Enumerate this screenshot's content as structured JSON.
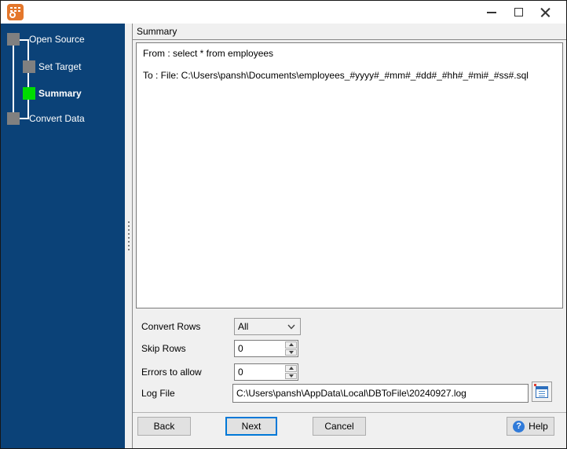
{
  "window": {
    "title": "",
    "app_icon": "database-to-file-app-icon",
    "controls": {
      "minimize": "minimize",
      "maximize": "maximize",
      "close": "close"
    }
  },
  "sidebar": {
    "steps": [
      {
        "label": "Open Source",
        "state": "done"
      },
      {
        "label": "Set Target",
        "state": "done"
      },
      {
        "label": "Summary",
        "state": "current"
      },
      {
        "label": "Convert Data",
        "state": "pending"
      }
    ]
  },
  "main": {
    "header": "Summary",
    "summary": {
      "from_line": "From : select * from employees",
      "to_line": "To : File: C:\\Users\\pansh\\Documents\\employees_#yyyy#_#mm#_#dd#_#hh#_#mi#_#ss#.sql"
    },
    "form": {
      "convert_rows": {
        "label": "Convert Rows",
        "value": "All"
      },
      "skip_rows": {
        "label": "Skip Rows",
        "value": "0"
      },
      "errors_to_allow": {
        "label": "Errors to allow",
        "value": "0"
      },
      "log_file": {
        "label": "Log File",
        "value": "C:\\Users\\pansh\\AppData\\Local\\DBToFile\\20240927.log"
      }
    },
    "buttons": {
      "back": "Back",
      "next": "Next",
      "cancel": "Cancel",
      "help": "Help",
      "help_icon_glyph": "?"
    }
  },
  "icons": {
    "app": "orange-database-file-icon",
    "combo_chevron": "chevron-down-icon",
    "spinner": "up-down-arrows-icon",
    "log_browse": "log-document-icon",
    "help": "question-mark-circle-icon"
  },
  "colors": {
    "sidebar_navy": "#0b4278",
    "step_current_green": "#00dc00",
    "step_gray": "#808080",
    "panel_gray": "#f0f0f0",
    "next_button_accent": "#0078d7",
    "app_icon_orange": "#e4772b",
    "help_icon_blue": "#2f7ad9"
  }
}
